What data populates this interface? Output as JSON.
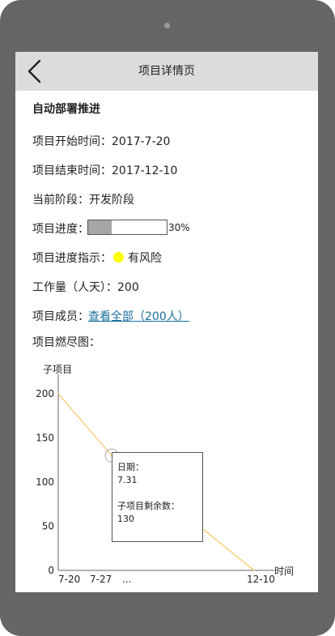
{
  "header": {
    "title": "项目详情页",
    "back_icon": "chevron-left-icon"
  },
  "project": {
    "name": "自动部署推进",
    "start_label": "项目开始时间：",
    "start_value": "2017-7-20",
    "end_label": "项目结束时间：",
    "end_value": "2017-12-10",
    "stage_label": "当前阶段：",
    "stage_value": "开发阶段",
    "progress_label": "项目进度：",
    "progress_value": 0.3,
    "progress_text": "30%",
    "risk_label": "项目进度指示：",
    "risk_status": "有风险",
    "risk_color": "#ffff00",
    "workload_label": "工作量（人天）：",
    "workload_value": "200",
    "members_label": "项目成员：",
    "members_link": "查看全部（200人）",
    "burndown_label": "项目燃尽图："
  },
  "chart_data": {
    "type": "line",
    "ylabel": "子项目",
    "xlabel": "时间",
    "yticks": [
      "200",
      "150",
      "100",
      "50",
      "0"
    ],
    "ytick_values": [
      200,
      150,
      100,
      50,
      0
    ],
    "ylim": [
      0,
      200
    ],
    "xtick_labels": [
      "7-20",
      "7-27",
      "...",
      "12-10"
    ],
    "series": [
      {
        "values": [
          200,
          130,
          0
        ],
        "x": [
          "7-20",
          "7-31",
          "12-10"
        ],
        "color": "#f5c86a"
      }
    ],
    "highlight": {
      "x": "7.31",
      "y": 130
    },
    "tooltip": {
      "date_label": "日期：",
      "date_value": "7.31",
      "remaining_label": "子项目剩余数：",
      "remaining_value": "130"
    }
  }
}
